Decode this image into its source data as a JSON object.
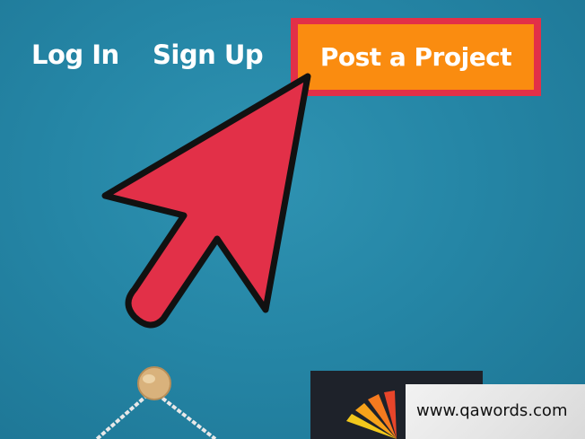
{
  "nav": {
    "login_label": "Log In",
    "signup_label": "Sign Up",
    "post_project_label": "Post a Project"
  },
  "watermark": {
    "text": "www.qawords.com"
  },
  "colors": {
    "background": "#2586a6",
    "post_button": "#fa8c10",
    "highlight": "#e23048",
    "arrow_fill": "#e23048",
    "arrow_outline": "#111111"
  },
  "icons": {
    "pointer": "red-arrow-icon"
  }
}
